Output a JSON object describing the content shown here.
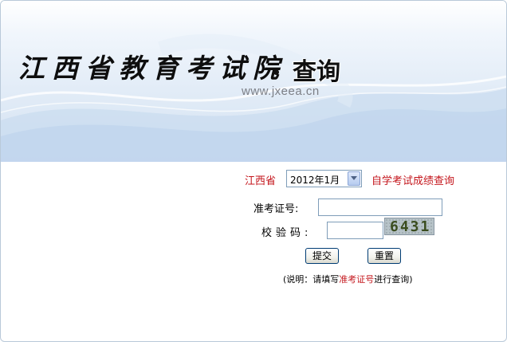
{
  "header": {
    "site_title": "江西省教育考试院",
    "query_title": "查询",
    "site_url": "www.jxeea.cn"
  },
  "form": {
    "province": "江西省",
    "exam_date_selected": "2012年1月",
    "exam_type": "自学考试成绩查询",
    "ticket_label": "准考证号:",
    "ticket_value": "",
    "code_label": "校验码:",
    "code_value": "",
    "captcha_text": "6431",
    "submit_label": "提交",
    "reset_label": "重置",
    "note_prefix": "(说明：请填写",
    "note_highlight": "准考证号",
    "note_suffix": "进行查询)"
  },
  "colors": {
    "accent_red": "#c4161c",
    "banner_blue": "#d4e2f2",
    "input_border": "#7f9db9"
  },
  "icons": {
    "select_arrow": "chevron-down-icon"
  }
}
